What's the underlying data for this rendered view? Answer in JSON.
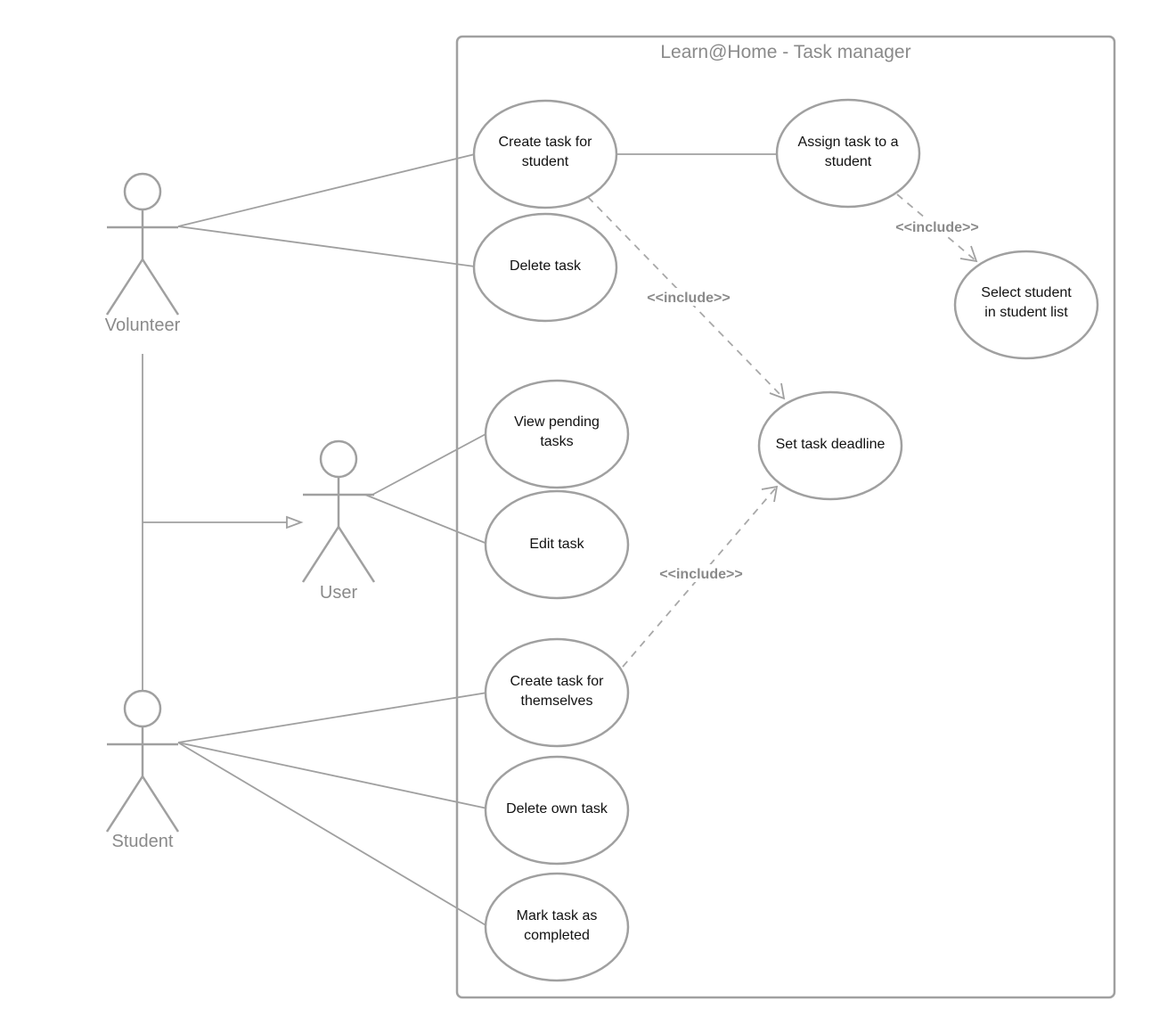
{
  "system": {
    "title": "Learn@Home - Task manager"
  },
  "actors": {
    "volunteer": "Volunteer",
    "user": "User",
    "student": "Student"
  },
  "use_cases": {
    "create_for_student": [
      "Create task for",
      "student"
    ],
    "delete_task": [
      "Delete task"
    ],
    "assign_task": [
      "Assign task to a",
      "student"
    ],
    "select_student": [
      "Select student",
      "in student list"
    ],
    "view_pending": [
      "View pending",
      "tasks"
    ],
    "edit_task": [
      "Edit task"
    ],
    "set_deadline": [
      "Set task deadline"
    ],
    "create_for_themselves": [
      "Create task for",
      "themselves"
    ],
    "delete_own": [
      "Delete own task"
    ],
    "mark_completed": [
      "Mark task as",
      "completed"
    ]
  },
  "relationships": {
    "include_label": "<<include>>",
    "includes": [
      {
        "from": "create_for_student",
        "to": "set_deadline"
      },
      {
        "from": "assign_task",
        "to": "select_student"
      },
      {
        "from": "create_for_themselves",
        "to": "set_deadline"
      }
    ],
    "associations": [
      {
        "actor": "volunteer",
        "use_case": "create_for_student"
      },
      {
        "actor": "volunteer",
        "use_case": "delete_task"
      },
      {
        "actor": "user",
        "use_case": "view_pending"
      },
      {
        "actor": "user",
        "use_case": "edit_task"
      },
      {
        "actor": "student",
        "use_case": "create_for_themselves"
      },
      {
        "actor": "student",
        "use_case": "delete_own"
      },
      {
        "actor": "student",
        "use_case": "mark_completed"
      },
      {
        "from": "create_for_student",
        "to": "assign_task"
      }
    ],
    "generalizations": [
      {
        "child": "volunteer",
        "parent": "user"
      },
      {
        "child": "student",
        "parent": "user"
      }
    ]
  },
  "colors": {
    "stroke": "#a0a0a0",
    "label": "#8a8a8a",
    "text": "#111111"
  }
}
